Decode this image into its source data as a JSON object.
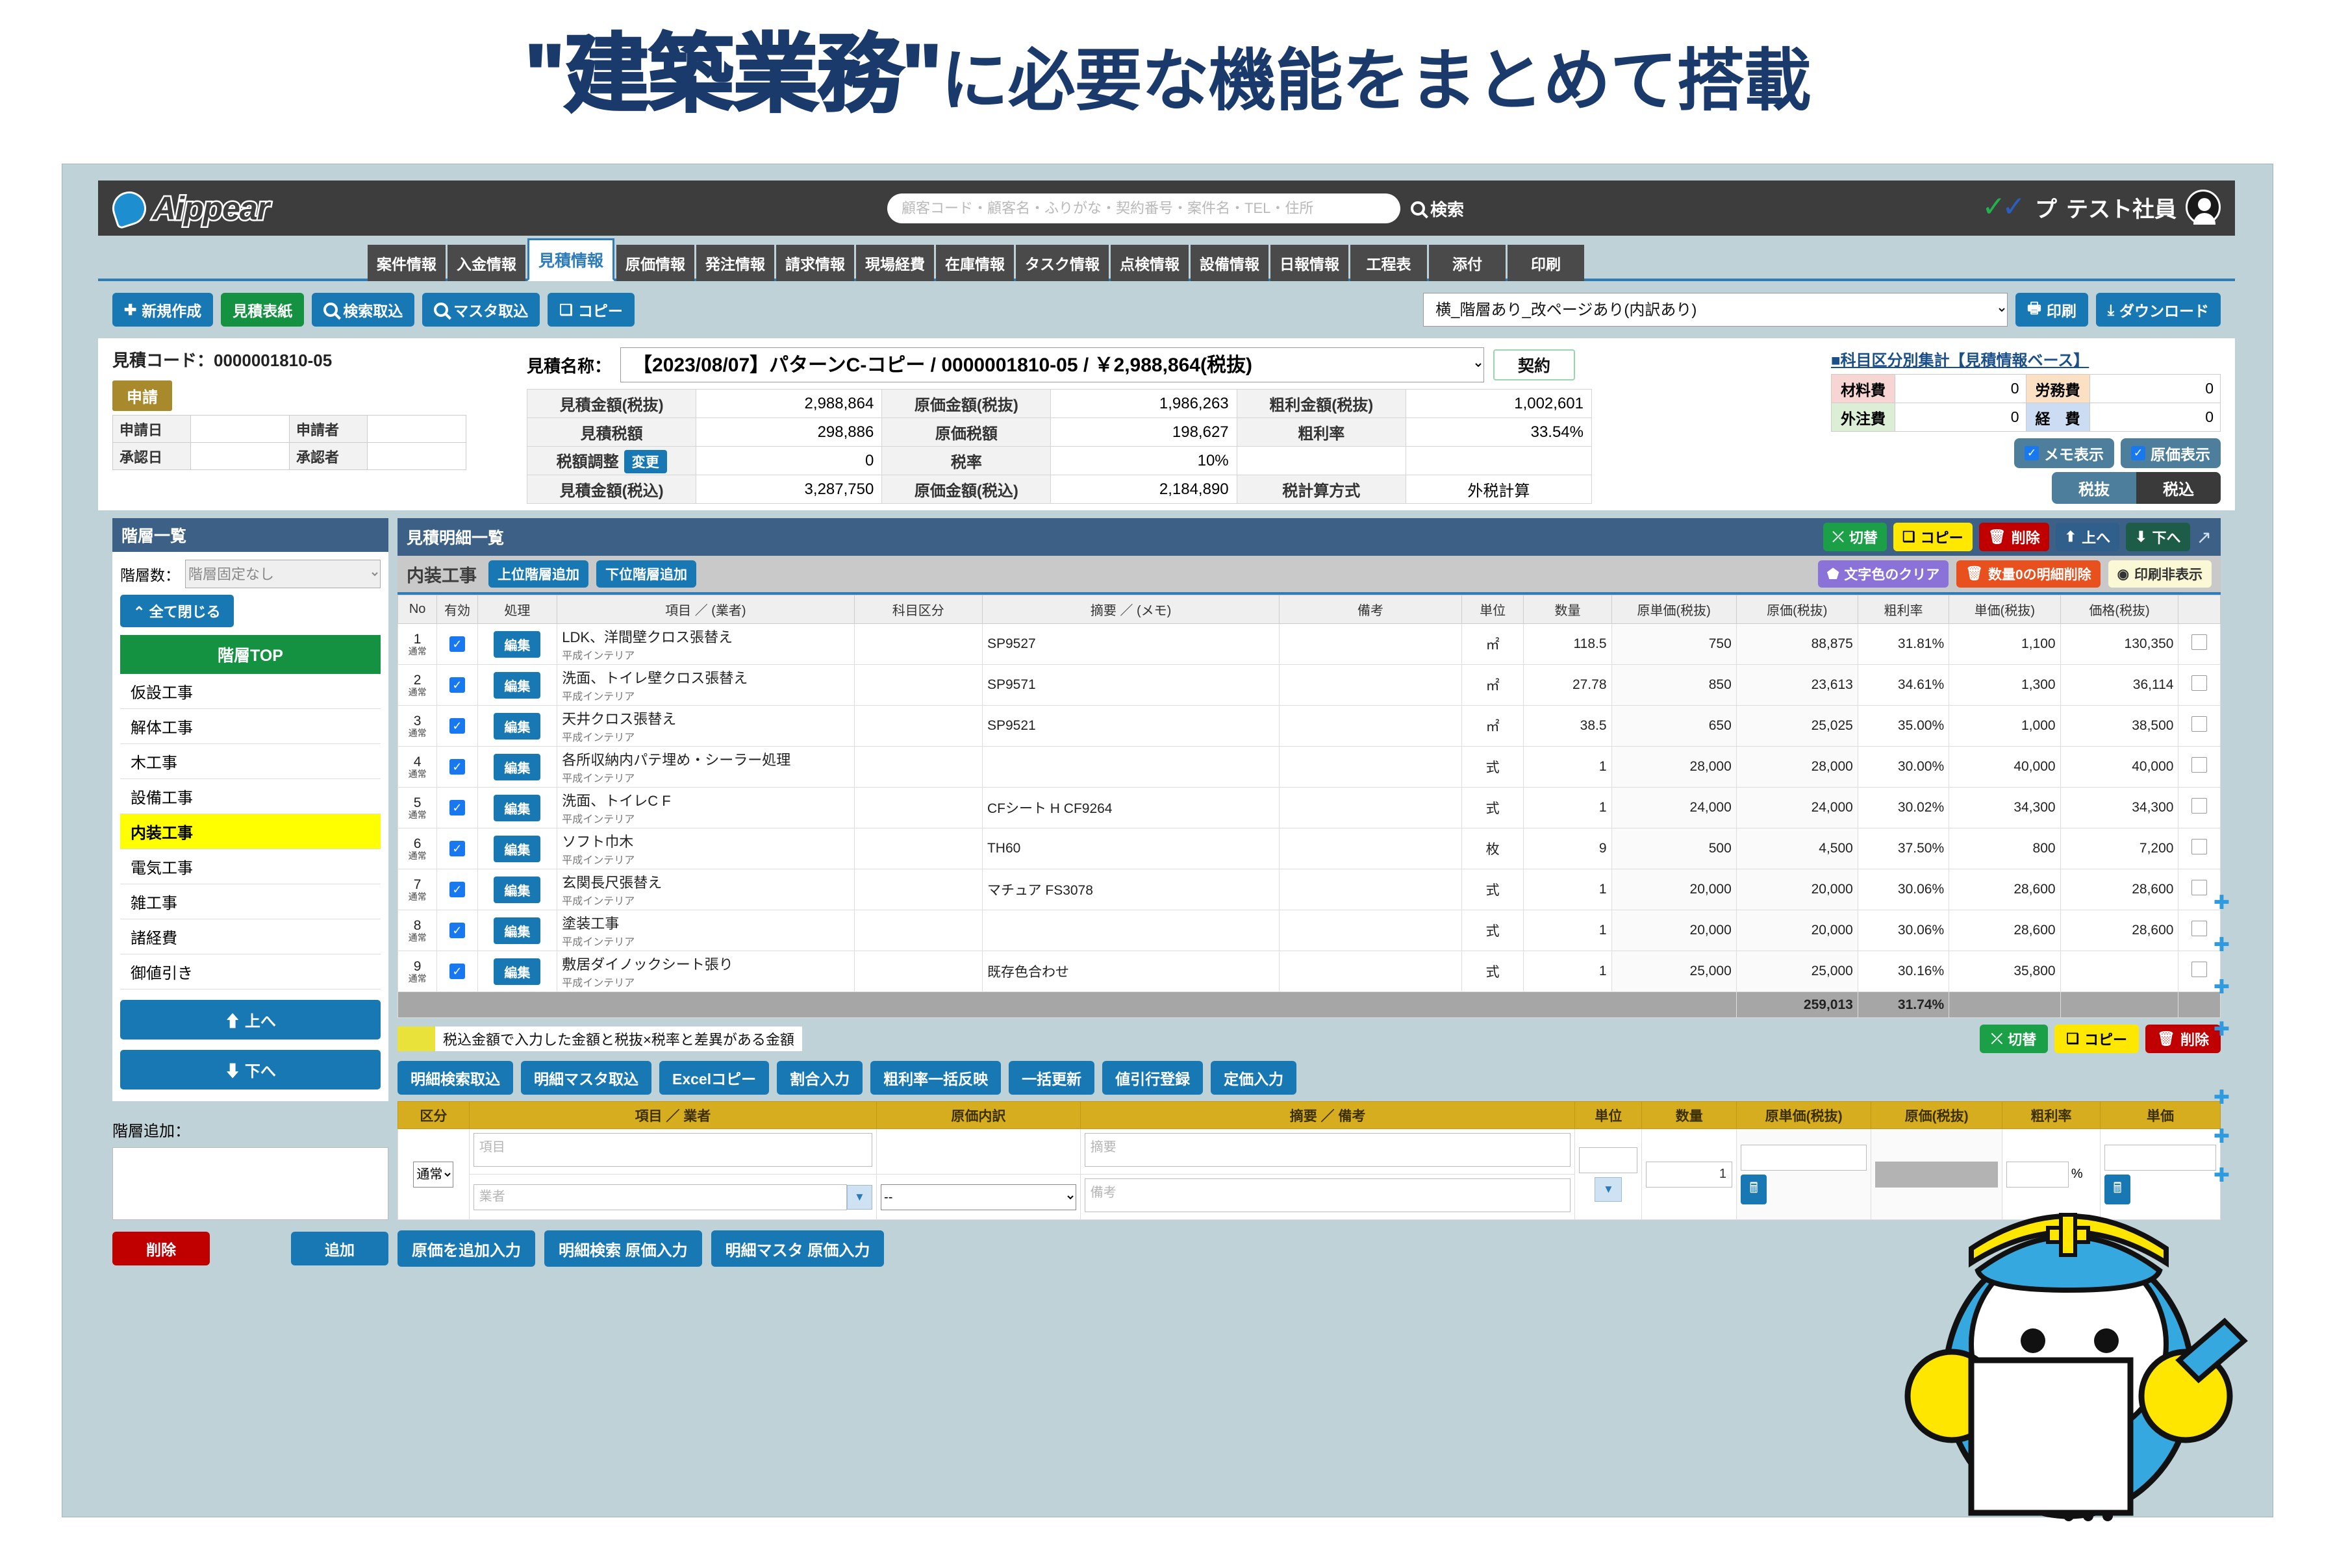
{
  "headline": {
    "quoted": "\"建築業務\"",
    "rest": "に必要な機能をまとめて搭載"
  },
  "topbar": {
    "logo_text": "Aippear",
    "search_placeholder": "顧客コード・顧客名・ふりがな・契約番号・案件名・TEL・住所",
    "search_value": "",
    "search_label": "検索",
    "user_brand": "プ",
    "user_name": "テスト社員"
  },
  "tabs": [
    {
      "label": "案件情報",
      "active": false
    },
    {
      "label": "入金情報",
      "active": false
    },
    {
      "label": "見積情報",
      "active": true
    },
    {
      "label": "原価情報",
      "active": false
    },
    {
      "label": "発注情報",
      "active": false
    },
    {
      "label": "請求情報",
      "active": false
    },
    {
      "label": "現場経費",
      "active": false
    },
    {
      "label": "在庫情報",
      "active": false
    },
    {
      "label": "タスク情報",
      "active": false
    },
    {
      "label": "点検情報",
      "active": false
    },
    {
      "label": "設備情報",
      "active": false
    },
    {
      "label": "日報情報",
      "active": false
    },
    {
      "label": "工程表",
      "active": false
    },
    {
      "label": "添付",
      "active": false
    },
    {
      "label": "印刷",
      "active": false
    }
  ],
  "actionbar": {
    "new": "新規作成",
    "cover": "見積表紙",
    "search_import": "検索取込",
    "master_import": "マスタ取込",
    "copy": "コピー",
    "layout_select": "横_階層あり_改ページあり(内訳あり)",
    "print": "印刷",
    "download": "ダウンロード"
  },
  "estimate": {
    "code_label": "見積コード：0000001810-05",
    "status_badge": "申請",
    "apply_date_label": "申請日",
    "apply_date_value": "",
    "applicant_label": "申請者",
    "applicant_value": "",
    "approve_date_label": "承認日",
    "approve_date_value": "",
    "approver_label": "承認者",
    "approver_value": "",
    "name_label": "見積名称：",
    "name_value": "【2023/08/07】パターンC-コピー / 0000001810-05 / ￥2,988,864(税抜)",
    "contract_button": "契約",
    "amounts": [
      {
        "k1": "見積金額(税抜)",
        "v1": "2,988,864",
        "k2": "原価金額(税抜)",
        "v2": "1,986,263",
        "k3": "粗利金額(税抜)",
        "v3": "1,002,601"
      },
      {
        "k1": "見積税額",
        "v1": "298,886",
        "k2": "原価税額",
        "v2": "198,627",
        "k3": "粗利率",
        "v3": "33.54%"
      },
      {
        "k1": "税額調整",
        "k1btn": "変更",
        "v1": "0",
        "k2": "税率",
        "v2": "10%",
        "k3": "",
        "v3": ""
      },
      {
        "k1": "見積金額(税込)",
        "v1": "3,287,750",
        "k2": "原価金額(税込)",
        "v2": "2,184,890",
        "k3": "税計算方式",
        "v3": "外税計算"
      }
    ],
    "summary_title": "■科目区分別集計【見積情報ベース】",
    "summary": [
      {
        "k1": "材料費",
        "v1": "0",
        "k2": "労務費",
        "v2": "0"
      },
      {
        "k1": "外注費",
        "v1": "0",
        "k2": "経　費",
        "v2": "0"
      }
    ],
    "chip_memo": "メモ表示",
    "chip_cost": "原価表示",
    "seg_excl": "税抜",
    "seg_incl": "税込"
  },
  "sidebar": {
    "title": "階層一覧",
    "levels_label": "階層数：",
    "levels_value": "階層固定なし",
    "close_all": "全て閉じる",
    "tier_top": "階層TOP",
    "tiers": [
      {
        "label": "仮設工事",
        "selected": false
      },
      {
        "label": "解体工事",
        "selected": false
      },
      {
        "label": "木工事",
        "selected": false
      },
      {
        "label": "設備工事",
        "selected": false
      },
      {
        "label": "内装工事",
        "selected": true
      },
      {
        "label": "電気工事",
        "selected": false
      },
      {
        "label": "雑工事",
        "selected": false
      },
      {
        "label": "諸経費",
        "selected": false
      },
      {
        "label": "御値引き",
        "selected": false
      }
    ],
    "move_up": "上へ",
    "move_down": "下へ",
    "add_label": "階層追加：",
    "add_value": "",
    "delete": "削除",
    "add": "追加"
  },
  "detail": {
    "title": "見積明細一覧",
    "head_buttons": {
      "toggle": "切替",
      "copy": "コピー",
      "delete": "削除",
      "up": "上へ",
      "down": "下へ"
    },
    "category": "内装工事",
    "add_upper": "上位階層追加",
    "add_lower": "下位階層追加",
    "clear_color": "文字色のクリア",
    "delete_zero": "数量0の明細削除",
    "print_hide": "印刷非表示",
    "columns": [
      "No",
      "有効",
      "処理",
      "項目 ／ (業者)",
      "科目区分",
      "摘要 ／ (メモ)",
      "備考",
      "単位",
      "数量",
      "原単価(税抜)",
      "原価(税抜)",
      "粗利率",
      "単価(税抜)",
      "価格(税抜)",
      ""
    ],
    "edit_label": "編集",
    "row_type": "通常",
    "rows": [
      {
        "no": "1",
        "item": "LDK、洋間壁クロス張替え",
        "vendor": "平成インテリア",
        "kamoku": "",
        "tekiyo": "SP9527",
        "biko": "",
        "unit": "㎡",
        "qty": "118.5",
        "unit_cost": "750",
        "cost": "88,875",
        "margin": "31.81%",
        "unit_price": "1,100",
        "price": "130,350"
      },
      {
        "no": "2",
        "item": "洗面、トイレ壁クロス張替え",
        "vendor": "平成インテリア",
        "kamoku": "",
        "tekiyo": "SP9571",
        "biko": "",
        "unit": "㎡",
        "qty": "27.78",
        "unit_cost": "850",
        "cost": "23,613",
        "margin": "34.61%",
        "unit_price": "1,300",
        "price": "36,114"
      },
      {
        "no": "3",
        "item": "天井クロス張替え",
        "vendor": "平成インテリア",
        "kamoku": "",
        "tekiyo": "SP9521",
        "biko": "",
        "unit": "㎡",
        "qty": "38.5",
        "unit_cost": "650",
        "cost": "25,025",
        "margin": "35.00%",
        "unit_price": "1,000",
        "price": "38,500"
      },
      {
        "no": "4",
        "item": "各所収納内パテ埋め・シーラー処理",
        "vendor": "平成インテリア",
        "kamoku": "",
        "tekiyo": "",
        "biko": "",
        "unit": "式",
        "qty": "1",
        "unit_cost": "28,000",
        "cost": "28,000",
        "margin": "30.00%",
        "unit_price": "40,000",
        "price": "40,000"
      },
      {
        "no": "5",
        "item": "洗面、トイレC F",
        "vendor": "平成インテリア",
        "kamoku": "",
        "tekiyo": "CFシート H CF9264",
        "biko": "",
        "unit": "式",
        "qty": "1",
        "unit_cost": "24,000",
        "cost": "24,000",
        "margin": "30.02%",
        "unit_price": "34,300",
        "price": "34,300"
      },
      {
        "no": "6",
        "item": "ソフト巾木",
        "vendor": "平成インテリア",
        "kamoku": "",
        "tekiyo": "TH60",
        "biko": "",
        "unit": "枚",
        "qty": "9",
        "unit_cost": "500",
        "cost": "4,500",
        "margin": "37.50%",
        "unit_price": "800",
        "price": "7,200"
      },
      {
        "no": "7",
        "item": "玄関長尺張替え",
        "vendor": "平成インテリア",
        "kamoku": "",
        "tekiyo": "マチュア FS3078",
        "biko": "",
        "unit": "式",
        "qty": "1",
        "unit_cost": "20,000",
        "cost": "20,000",
        "margin": "30.06%",
        "unit_price": "28,600",
        "price": "28,600"
      },
      {
        "no": "8",
        "item": "塗装工事",
        "vendor": "平成インテリア",
        "kamoku": "",
        "tekiyo": "",
        "biko": "",
        "unit": "式",
        "qty": "1",
        "unit_cost": "20,000",
        "cost": "20,000",
        "margin": "30.06%",
        "unit_price": "28,600",
        "price": "28,600"
      },
      {
        "no": "9",
        "item": "敷居ダイノックシート張り",
        "vendor": "平成インテリア",
        "kamoku": "",
        "tekiyo": "既存色合わせ",
        "biko": "",
        "unit": "式",
        "qty": "1",
        "unit_cost": "25,000",
        "cost": "25,000",
        "margin": "30.16%",
        "unit_price": "35,800",
        "price": ""
      }
    ],
    "total_cost": "259,013",
    "total_margin": "31.74%"
  },
  "legend": {
    "text": "税込金額で入力した金額と税抜×税率と差異がある金額",
    "toggle": "切替",
    "copy": "コピー",
    "delete": "削除"
  },
  "toolbuttons": [
    "明細検索取込",
    "明細マスタ取込",
    "Excelコピー",
    "割合入力",
    "粗利率一括反映",
    "一括更新",
    "値引行登録",
    "定価入力"
  ],
  "entry": {
    "columns": [
      "区分",
      "項目 ／ 業者",
      "原価内訳",
      "摘要 ／ 備考",
      "単位",
      "数量",
      "原単価(税抜)",
      "原価(税抜)",
      "粗利率",
      "単価"
    ],
    "kubun_value": "通常",
    "item_placeholder": "項目",
    "vendor_placeholder": "業者",
    "breakdown_value": "--",
    "tekiyo_placeholder": "摘要",
    "biko_placeholder": "備考",
    "unit_value": "",
    "qty_value": "1",
    "unit_cost_value": "",
    "cost_value": "",
    "margin_value": "",
    "margin_suffix": "%"
  },
  "bottom_buttons": [
    "原価を追加入力",
    "明細検索 原価入力",
    "明細マスタ 原価入力"
  ]
}
